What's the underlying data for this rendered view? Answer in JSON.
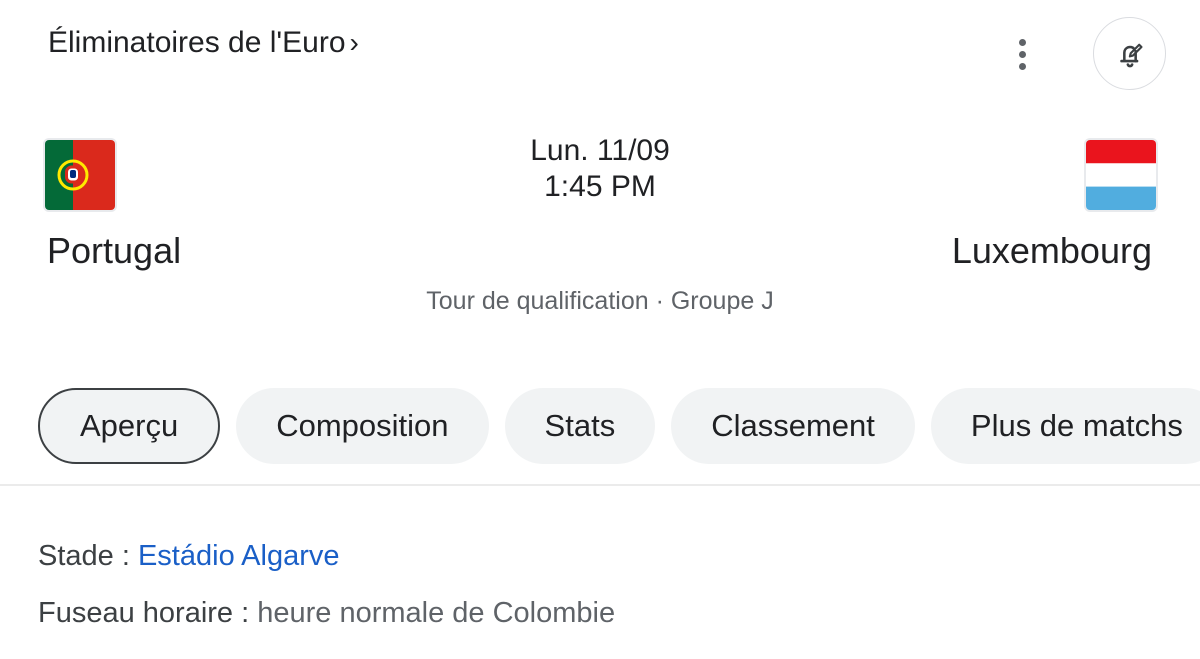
{
  "header": {
    "competition": "Éliminatoires de l'Euro",
    "chevron": "›"
  },
  "match": {
    "date": "Lun. 11/09",
    "time": "1:45 PM",
    "stage": "Tour de qualification · Groupe J",
    "home": {
      "name": "Portugal",
      "flag_colors": [
        "#046a38",
        "#da291c",
        "#ffe900"
      ]
    },
    "away": {
      "name": "Luxembourg",
      "flag_colors": [
        "#ea141d",
        "#ffffff",
        "#51addf"
      ]
    }
  },
  "tabs": [
    {
      "label": "Aperçu",
      "active": true
    },
    {
      "label": "Composition",
      "active": false
    },
    {
      "label": "Stats",
      "active": false
    },
    {
      "label": "Classement",
      "active": false
    },
    {
      "label": "Plus de matchs",
      "active": false
    }
  ],
  "details": {
    "stadium_label": "Stade : ",
    "stadium_value": "Estádio Algarve",
    "timezone_label": "Fuseau horaire : ",
    "timezone_value": "heure normale de Colombie"
  },
  "icons": {
    "more": "more-vert-icon",
    "bell": "bell-edit-icon"
  }
}
